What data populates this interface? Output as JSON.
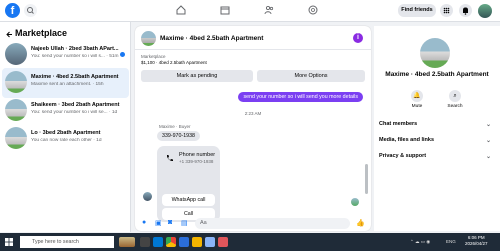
{
  "topbar": {
    "logo": "f",
    "nav_icons": [
      "home-icon",
      "calendar-icon",
      "friends-icon",
      "groups-icon"
    ],
    "find_friends": "Find friends",
    "right_icons": [
      "menu-grid-icon",
      "messenger-icon",
      "bell-icon",
      "profile-avatar"
    ]
  },
  "left": {
    "title": "Marketplace",
    "back_icon": "back-arrow-icon",
    "threads": [
      {
        "title": "Najeeb Ullah · 2bed 3bath APart...",
        "sub": "You: send your number so i will s... · 51m",
        "unread": true
      },
      {
        "title": "Maxime · 4bed 2.5bath Apartment",
        "sub": "Maxime sent an attachment. · 15h",
        "unread": false
      },
      {
        "title": "Shaikeem · 3bed 2bath Apartment",
        "sub": "You: send your number so i will se... · 1d",
        "unread": false
      },
      {
        "title": "Lo · 3bed 2bath Apartment",
        "sub": "You can now rate each other · 1d",
        "unread": false
      }
    ]
  },
  "chat": {
    "header_title": "Maxime · 4bed 2.5bath Apartment",
    "info_icon": "i",
    "listing_label": "Marketplace",
    "listing_price": "$1,100 · 4bed 2.5bath Apartment",
    "mark_pending": "Mark as pending",
    "more_options": "More Options",
    "outgoing_message": "send your number so i will send you more details",
    "timestamp": "2:23 AM",
    "buyer_label": "Maxime · Buyer",
    "incoming_number": "339-970-1938",
    "card_title": "Phone number",
    "card_number": "+1 339-970-1938",
    "whatsapp_btn": "WhatsApp call",
    "call_btn": "Call",
    "composer_placeholder": "Aa"
  },
  "right": {
    "title": "Maxime · 4bed 2.5bath Apartment",
    "mute": "Mute",
    "search": "Search",
    "sections": [
      "Chat members",
      "Media, files and links",
      "Privacy & support"
    ]
  },
  "taskbar": {
    "search_placeholder": "Type here to search",
    "lang": "ENG",
    "time": "6:06 PM",
    "date": "2026/04/27"
  },
  "colors": {
    "brand": "#1877f2",
    "outgoing_bubble": "#7b3ff2",
    "taskbar": "#1f2b38"
  }
}
